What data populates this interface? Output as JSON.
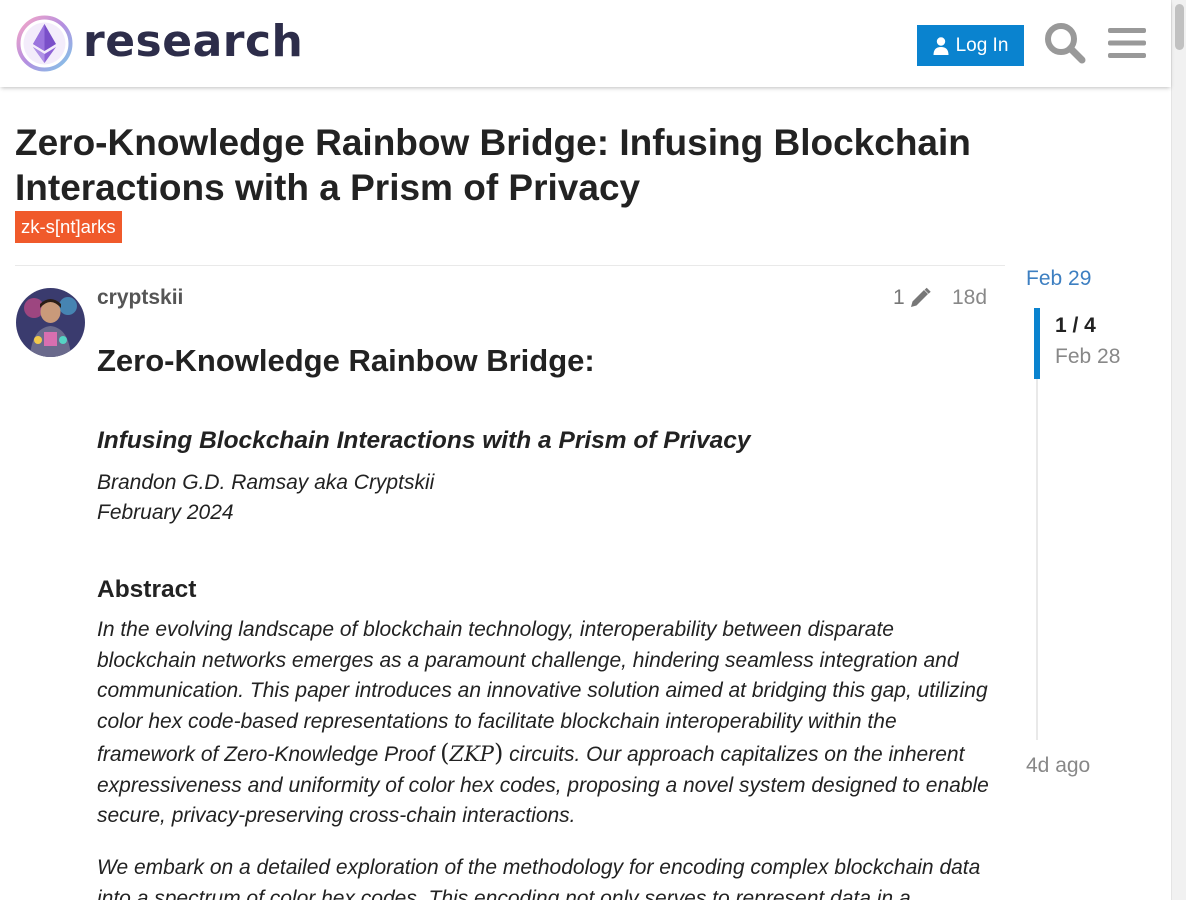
{
  "header": {
    "site_name": "research",
    "login_label": "Log In"
  },
  "topic": {
    "title": "Zero-Knowledge Rainbow Bridge: Infusing Blockchain Interactions with a Prism of Privacy",
    "tag": "zk-s[nt]arks"
  },
  "post": {
    "username": "cryptskii",
    "edit_count": "1",
    "age": "18d",
    "heading": "Zero-Knowledge Rainbow Bridge:",
    "subheading": "Infusing Blockchain Interactions with a Prism of Privacy",
    "author": "Brandon G.D. Ramsay aka Cryptskii",
    "date": "February 2024",
    "abstract_title": "Abstract",
    "abstract_p1_a": "In the evolving landscape of blockchain technology, interoperability between disparate blockchain networks emerges as a paramount challenge, hindering seamless integration and communication. This paper introduces an innovative solution aimed at bridging this gap, utilizing color hex code-based representations to facilitate blockchain interoperability within the framework of Zero-Knowledge Proof ",
    "abstract_math": "ZKP",
    "abstract_p1_b": " circuits. Our approach capitalizes on the inherent expressiveness and uniformity of color hex codes, proposing a novel system designed to enable secure, privacy-preserving cross-chain interactions.",
    "abstract_p2": "We embark on a detailed exploration of the methodology for encoding complex blockchain data into a spectrum of color hex codes. This encoding not only serves to represent data in a"
  },
  "timeline": {
    "start": "Feb 29",
    "position": "1 / 4",
    "current_date": "Feb 28",
    "end": "4d ago"
  },
  "colors": {
    "accent": "#0a83cf",
    "tag": "#f05a2b",
    "text": "#222222",
    "muted": "#888888",
    "link": "#3d7fc1"
  },
  "icons": [
    "logo-icon",
    "user-icon",
    "search-icon",
    "menu-icon",
    "pencil-icon"
  ]
}
